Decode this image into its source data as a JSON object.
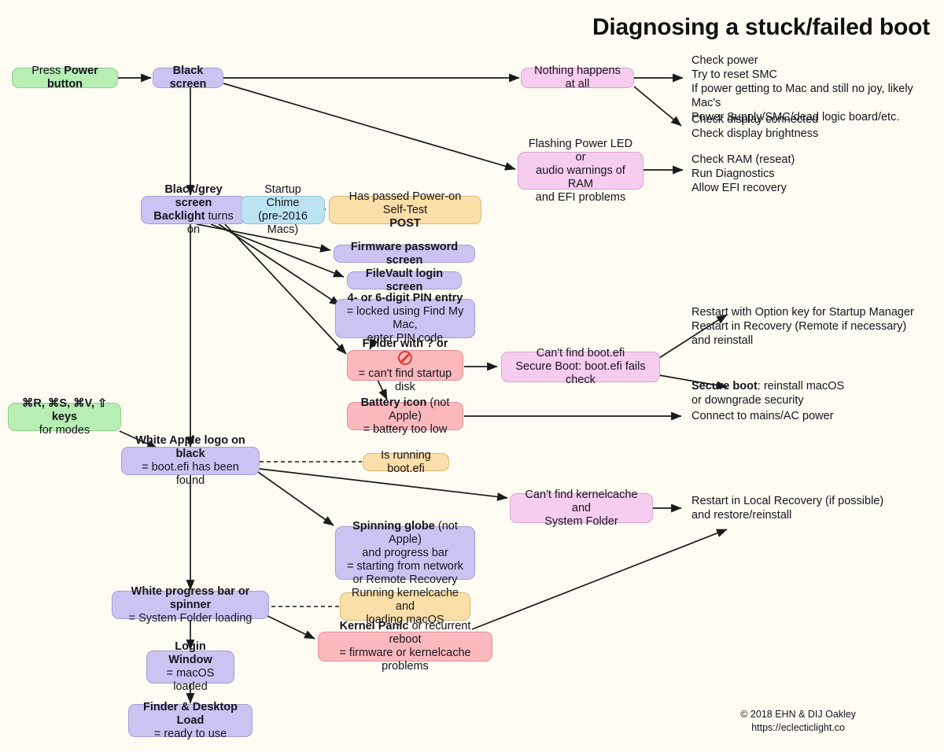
{
  "title": "Diagnosing a stuck/failed boot",
  "footer": {
    "copyright": "© 2018 EHN & DIJ Oakley",
    "url": "https://eclecticlight.co"
  },
  "nodes": {
    "press_power": {
      "line1_pre": "Press ",
      "line1_bold": "Power button"
    },
    "black_screen": {
      "label": "Black screen"
    },
    "nothing_happens": {
      "label": "Nothing happens at all"
    },
    "flashing_led": {
      "label": "Flashing Power LED or\naudio warnings of RAM\nand EFI problems"
    },
    "black_grey": {
      "bold1": "Black/grey screen",
      "bold2": "Backlight",
      "rest2": " turns on"
    },
    "startup_chime": {
      "line1": "Startup Chime",
      "line2": "(pre-2016 Macs)"
    },
    "post": {
      "line1": "Has passed Power-on Self-Test",
      "bold2": "POST"
    },
    "firmware_password": {
      "label": "Firmware password screen"
    },
    "filevault": {
      "label": "FileVault login screen"
    },
    "pin_entry": {
      "bold1": "4- or 6-digit PIN entry",
      "line2": "= locked using Find My Mac,",
      "line3": "enter PIN code"
    },
    "folder_question": {
      "bold1": "Folder with ? or ",
      "icon": "no-entry-icon",
      "line2": "= can't find startup disk"
    },
    "battery_icon": {
      "bold1": "Battery icon",
      "rest1": " (not Apple)",
      "line2": "= battery too low"
    },
    "cant_find_bootefi": {
      "line1": "Can't find boot.efi",
      "line2": "Secure Boot: boot.efi fails check"
    },
    "modifier_keys": {
      "line1": "⌘R, ⌘S, ⌘V, ⇧ keys",
      "line2": "for modes"
    },
    "white_apple": {
      "bold1": "White Apple logo on black",
      "line2": "= boot.efi has been found"
    },
    "is_running_bootefi": {
      "label": "Is running boot.efi"
    },
    "cant_find_kernelcache": {
      "line1": "Can't find kernelcache and",
      "line2": "System Folder"
    },
    "spinning_globe": {
      "bold1": "Spinning globe",
      "rest1": " (not Apple)",
      "line2": "and progress bar",
      "line3": "= starting from network",
      "line4": "or Remote Recovery"
    },
    "white_progress": {
      "bold1": "White progress bar or spinner",
      "line2": "= System Folder loading"
    },
    "running_kernelcache": {
      "line1": "Running kernelcache and",
      "line2": "loading macOS"
    },
    "kernel_panic": {
      "bold1": "Kernel Panic",
      "rest1": " or recurrent reboot",
      "line2": "= firmware or kernelcache problems"
    },
    "login_window": {
      "bold1": "Login Window",
      "line2": "= macOS loaded"
    },
    "finder_desktop": {
      "bold1": "Finder & Desktop Load",
      "line2": "= ready to use"
    }
  },
  "notes": {
    "check_power": "Check power\nTry to reset SMC\nIf power getting to Mac and still no joy, likely Mac's\nPower Supply/SMC/dead logic board/etc.",
    "check_display": "Check display connected\nCheck display brightness",
    "check_ram": "Check RAM (reseat)\nRun Diagnostics\nAllow EFI recovery",
    "restart_option": "Restart with Option key for Startup Manager\nRestart in Recovery (Remote if necessary)\nand reinstall",
    "secure_boot_bold": "Secure boot",
    "secure_boot_rest": ": reinstall macOS",
    "secure_boot_line2": "or downgrade security",
    "connect_mains": "Connect to mains/AC power",
    "restart_local_recovery": "Restart in Local Recovery (if possible)\nand restore/reinstall"
  },
  "colors": {
    "background": "#fdfbf2",
    "purple": "#cdc3f2",
    "green": "#b6eeb4",
    "blue": "#bbe3f2",
    "orange": "#fbdfa8",
    "pink": "#f7cdef",
    "red": "#fcb9bd",
    "edge": "#1a1a1a"
  }
}
